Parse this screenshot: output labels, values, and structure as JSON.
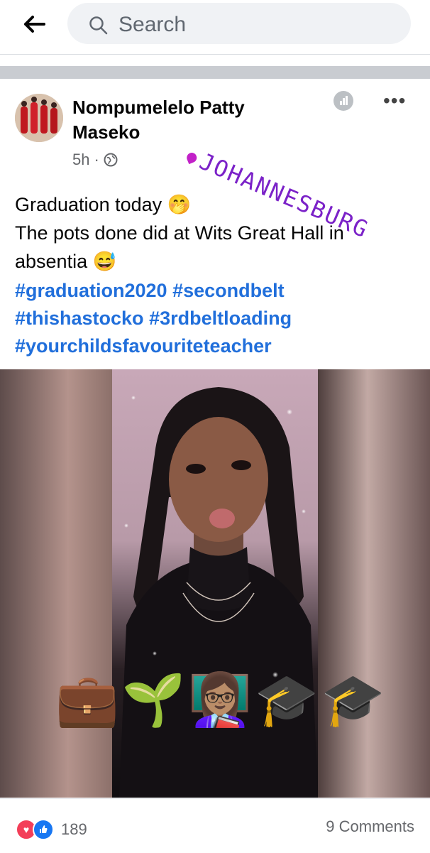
{
  "search": {
    "placeholder": "Search"
  },
  "post": {
    "author": "Nompumelelo Patty Maseko",
    "time": "5h",
    "location_sticker": "JOHANNESBURG",
    "text_line1": "Graduation today 🤭",
    "text_line2": "The pots done did at Wits Great Hall in absentia 😅",
    "hashtags": [
      "#graduation2020",
      "#secondbelt",
      "#thishastocko",
      "#3rdbeltloading",
      "#yourchildsfavouriteteacher"
    ],
    "photo_emojis": [
      "💼",
      "🌱",
      "👩🏽‍🏫",
      "🎓",
      "🎓"
    ],
    "reaction_count": "189",
    "comments": "9 Comments"
  },
  "icons": {
    "back": "arrow-left-icon",
    "search": "search-icon",
    "globe": "globe-icon",
    "insights": "insights-icon",
    "more": "more-options-icon",
    "love": "love-reaction-icon",
    "like": "like-reaction-icon"
  }
}
